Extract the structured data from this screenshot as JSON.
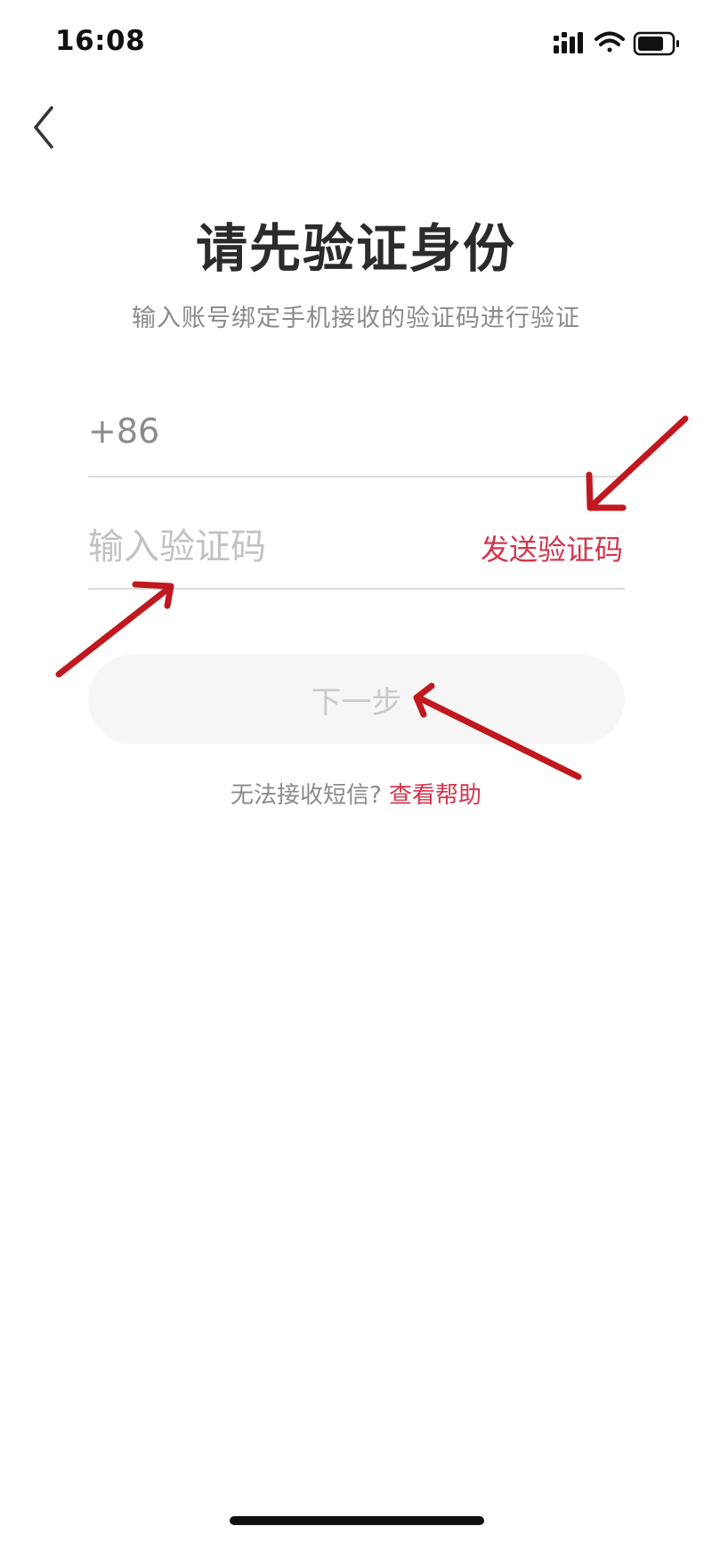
{
  "status_bar": {
    "time": "16:08",
    "icons": [
      "signal-icon",
      "wifi-icon",
      "battery-icon"
    ]
  },
  "header": {
    "back_icon": "chevron-left-icon",
    "title": "请先验证身份",
    "subtitle": "输入账号绑定手机接收的验证码进行验证"
  },
  "form": {
    "phone_prefix": "+86",
    "code_placeholder": "输入验证码",
    "send_code_label": "发送验证码",
    "next_label": "下一步"
  },
  "help": {
    "text": "无法接收短信?",
    "link_label": "查看帮助"
  },
  "colors": {
    "accent": "#d2354d",
    "annotation_arrow": "#c0181e",
    "button_bg": "#f6f6f6"
  }
}
